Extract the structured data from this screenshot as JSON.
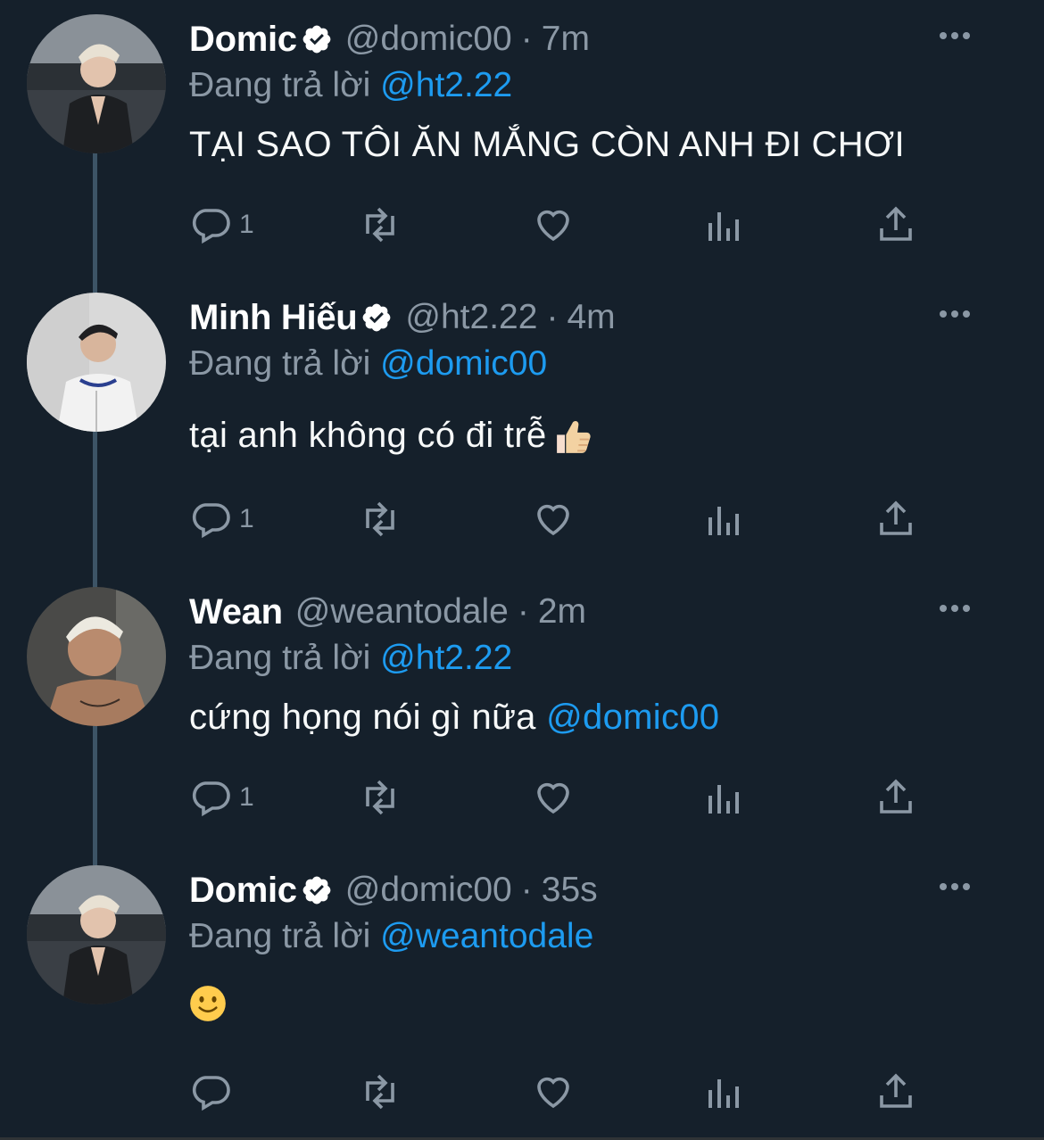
{
  "tweets": [
    {
      "name": "Domic",
      "handle": "@domic00",
      "dot": "·",
      "time": "7m",
      "replying_prefix": "Đang trả lời",
      "replying_to": "@ht2.22",
      "text": "TẠI SAO TÔI ĂN MẮNG CÒN ANH ĐI CHƠI",
      "text_mention": "",
      "reply_count": "1",
      "avatar": "domic-avatar"
    },
    {
      "name": "Minh Hiếu",
      "handle": "@ht2.22",
      "dot": "·",
      "time": "4m",
      "replying_prefix": "Đang trả lời",
      "replying_to": "@domic00",
      "text": "tại anh không có đi trễ",
      "text_mention": "",
      "reply_count": "1",
      "avatar": "minhhieu-avatar"
    },
    {
      "name": "Wean",
      "handle": "@weantodale",
      "dot": "·",
      "time": "2m",
      "replying_prefix": "Đang trả lời",
      "replying_to": "@ht2.22",
      "text": "cứng họng nói gì nữa ",
      "text_mention": "@domic00",
      "reply_count": "1",
      "avatar": "wean-avatar"
    },
    {
      "name": "Domic",
      "handle": "@domic00",
      "dot": "·",
      "time": "35s",
      "replying_prefix": "Đang trả lời",
      "replying_to": "@weantodale",
      "text": "",
      "text_mention": "",
      "reply_count": "",
      "avatar": "domic-avatar"
    }
  ],
  "colors": {
    "background": "#15202b",
    "secondary_text": "#8b98a5",
    "link": "#1d9bf0",
    "thread_line": "#3d5466"
  },
  "icons": [
    "verified-badge-icon",
    "more-icon",
    "reply-icon",
    "retweet-icon",
    "like-icon",
    "views-icon",
    "share-icon",
    "thumbs-up-emoji",
    "smile-emoji"
  ]
}
